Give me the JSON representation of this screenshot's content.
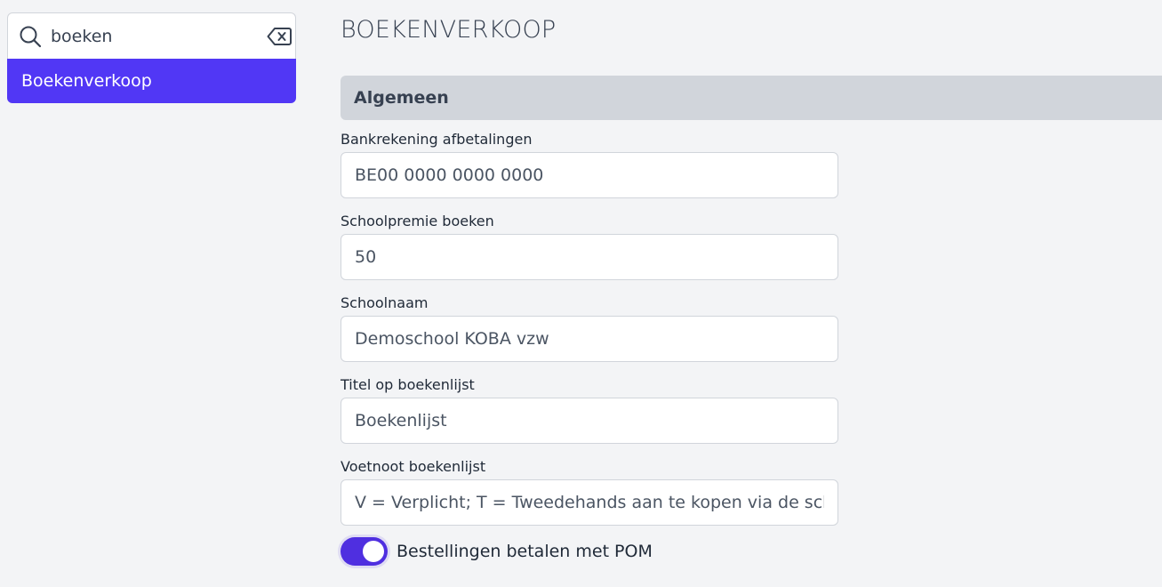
{
  "sidebar": {
    "search": {
      "value": "boeken",
      "icon": "search-icon",
      "clear_icon": "backspace-clear-icon"
    },
    "results": [
      {
        "label": "Boekenverkoop",
        "selected": true
      }
    ]
  },
  "main": {
    "title": "BOEKENVERKOOP",
    "section": "Algemeen",
    "fields": [
      {
        "label": "Bankrekening afbetalingen",
        "value": "BE00 0000 0000 0000"
      },
      {
        "label": "Schoolpremie boeken",
        "value": "50"
      },
      {
        "label": "Schoolnaam",
        "value": "Demoschool KOBA vzw"
      },
      {
        "label": "Titel op boekenlijst",
        "value": "Boekenlijst"
      },
      {
        "label": "Voetnoot boekenlijst",
        "value": "V = Verplicht; T = Tweedehands aan te kopen via de school"
      }
    ],
    "toggle": {
      "label": "Bestellingen betalen met POM",
      "on": true
    }
  },
  "colors": {
    "accent": "#5137f5",
    "toggle_on": "#4f2fe0",
    "section_bg": "#d1d5db",
    "page_bg": "#f3f4f6"
  }
}
